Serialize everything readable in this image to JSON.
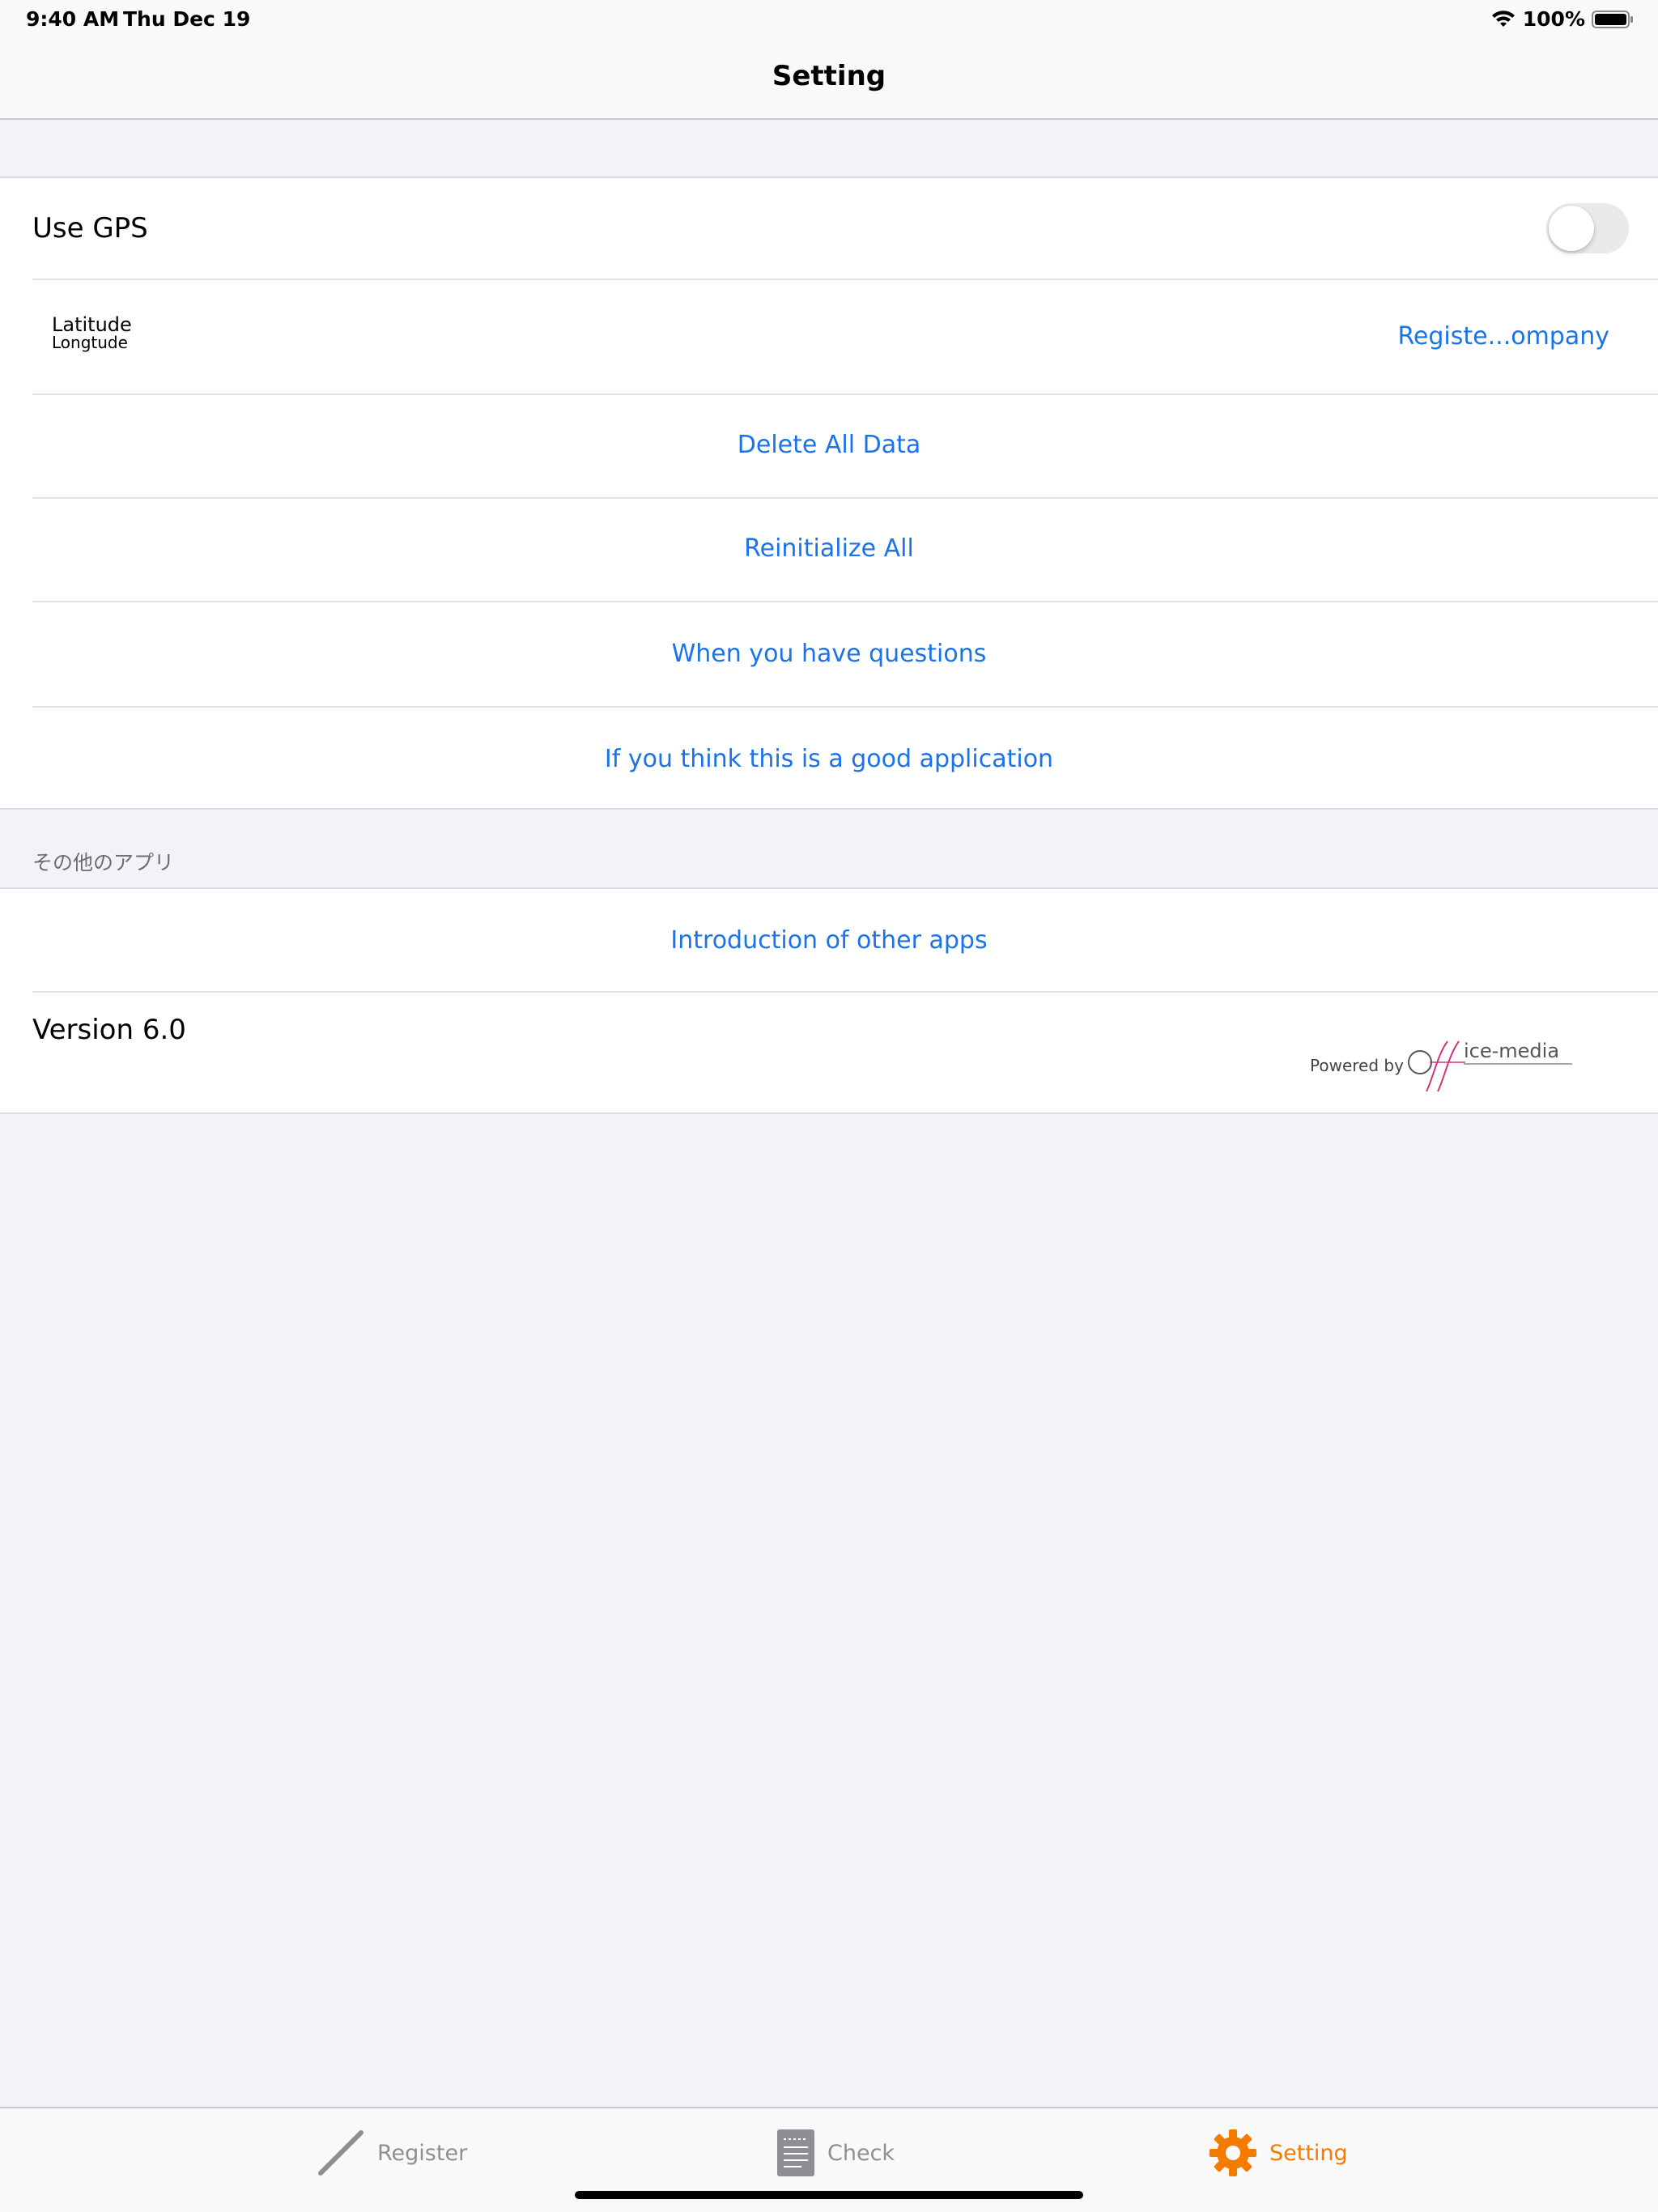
{
  "status_bar": {
    "time": "9:40 AM",
    "date": "Thu Dec 19",
    "battery": "100%"
  },
  "nav": {
    "title": "Setting"
  },
  "settings": {
    "use_gps_label": "Use GPS",
    "use_gps_on": false,
    "latitude_label": "Latitude",
    "longitude_label": "Longtude",
    "register_company": "Registe...ompany",
    "delete_all": "Delete All Data",
    "reinitialize": "Reinitialize All",
    "questions": "When you have questions",
    "good_app": "If you think this is a good application"
  },
  "other_apps": {
    "section_header": "その他のアプリ",
    "intro": "Introduction of other apps",
    "version": "Version 6.0",
    "powered_by": "Powered by",
    "logo_text": "ice-media"
  },
  "tabs": [
    {
      "label": "Register",
      "icon": "pencil-icon",
      "active": false
    },
    {
      "label": "Check",
      "icon": "document-icon",
      "active": false
    },
    {
      "label": "Setting",
      "icon": "gear-icon",
      "active": true
    }
  ],
  "colors": {
    "accent": "#1a73e8",
    "active_tab": "#f27b00",
    "inactive_tab": "#8e8e93"
  }
}
